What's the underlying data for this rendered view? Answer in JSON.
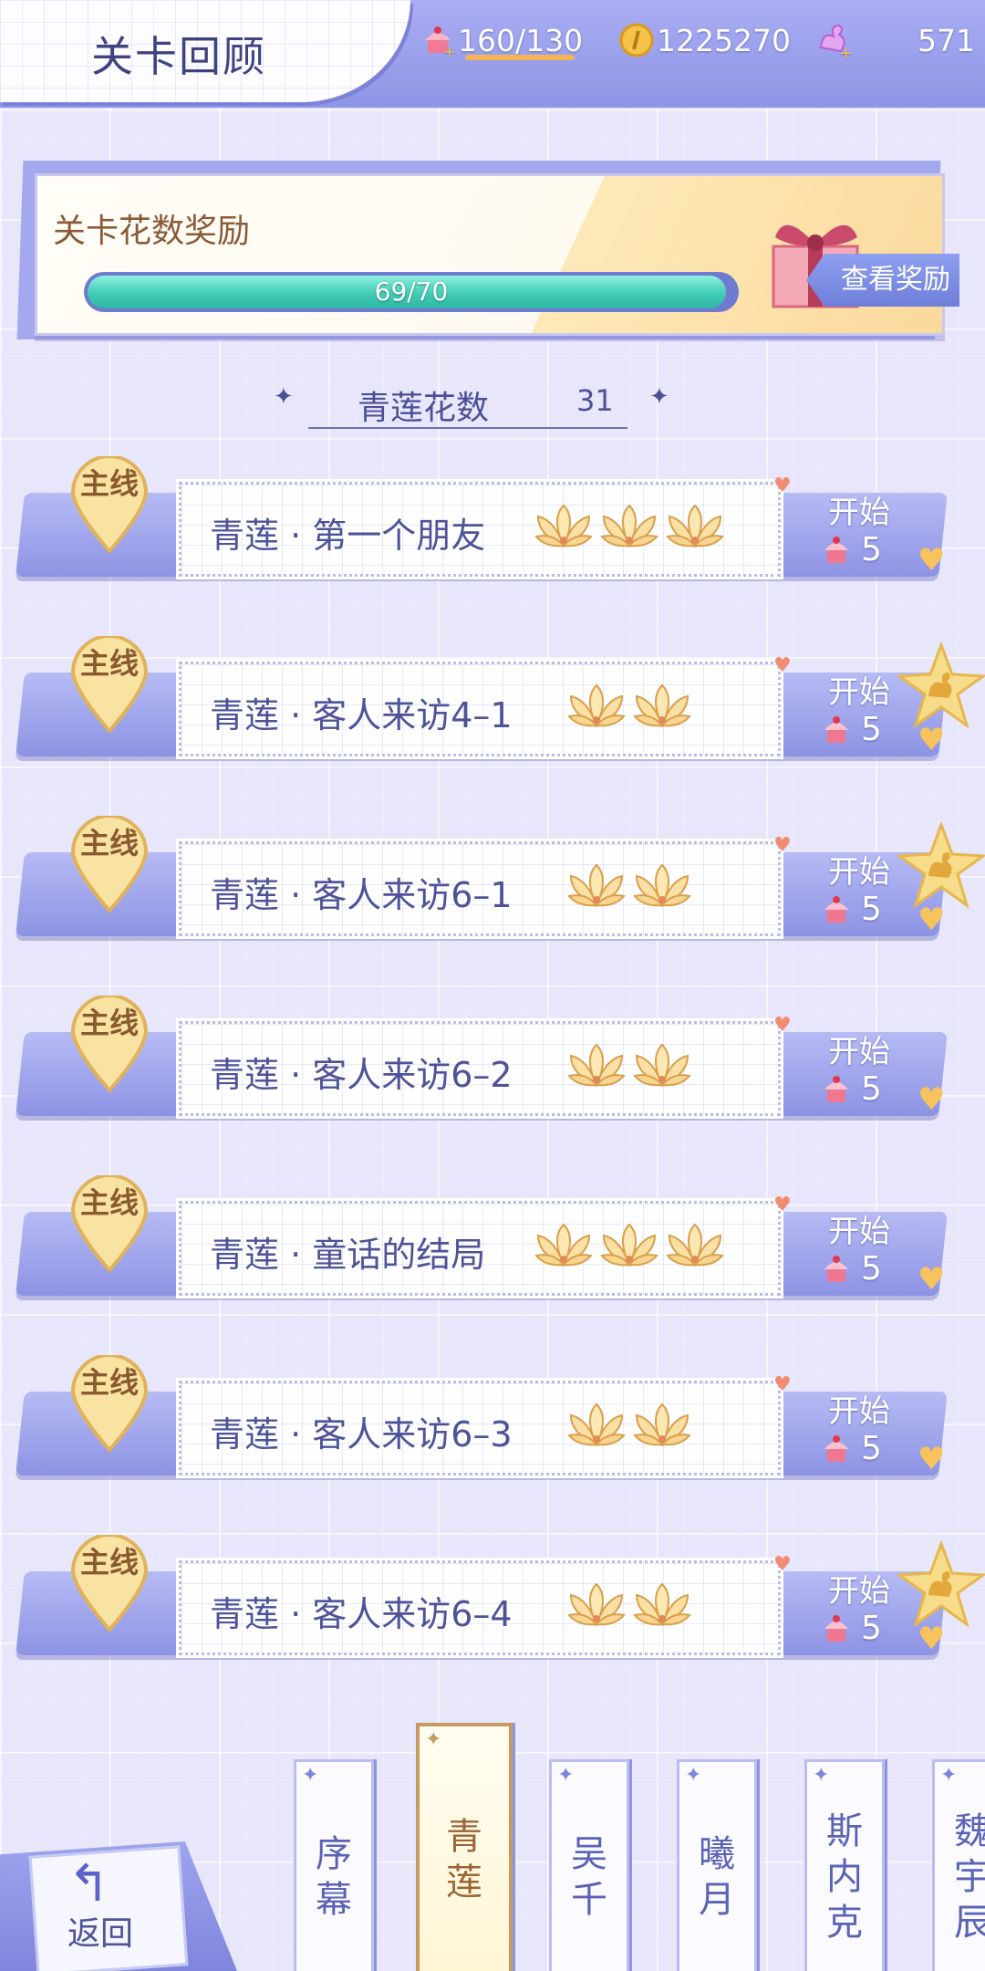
{
  "header": {
    "title": "关卡回顾",
    "stamina": "160/130",
    "coins": "1225270",
    "diamonds": "571"
  },
  "reward": {
    "title": "关卡花数奖励",
    "progress_text": "69/70",
    "progress_value": 0.9857,
    "button_label": "查看奖励"
  },
  "flower_count": {
    "label": "青莲花数",
    "value": "31"
  },
  "levels": [
    {
      "badge": "主线",
      "name": "青莲 · 第一个朋友",
      "flowers": 3,
      "start_label": "开始",
      "cost": "5",
      "star_badge": false
    },
    {
      "badge": "主线",
      "name": "青莲 · 客人来访4–1",
      "flowers": 2,
      "start_label": "开始",
      "cost": "5",
      "star_badge": true
    },
    {
      "badge": "主线",
      "name": "青莲 · 客人来访6–1",
      "flowers": 2,
      "start_label": "开始",
      "cost": "5",
      "star_badge": true
    },
    {
      "badge": "主线",
      "name": "青莲 · 客人来访6–2",
      "flowers": 2,
      "start_label": "开始",
      "cost": "5",
      "star_badge": false
    },
    {
      "badge": "主线",
      "name": "青莲 · 童话的结局",
      "flowers": 3,
      "start_label": "开始",
      "cost": "5",
      "star_badge": false
    },
    {
      "badge": "主线",
      "name": "青莲 · 客人来访6–3",
      "flowers": 2,
      "start_label": "开始",
      "cost": "5",
      "star_badge": false
    },
    {
      "badge": "主线",
      "name": "青莲 · 客人来访6–4",
      "flowers": 2,
      "start_label": "开始",
      "cost": "5",
      "star_badge": true
    }
  ],
  "tabs": [
    {
      "label": "序幕",
      "active": false
    },
    {
      "label": "青莲",
      "active": true
    },
    {
      "label": "吴千",
      "active": false
    },
    {
      "label": "曦月",
      "active": false
    },
    {
      "label": "斯内克",
      "active": false
    },
    {
      "label": "魏宇辰",
      "active": false
    }
  ],
  "back_button": {
    "label": "返回"
  },
  "icons": {
    "stamina": "cupcake-icon",
    "coins": "coin-icon",
    "diamonds": "swan-crystal-icon",
    "cost": "cupcake-icon",
    "flower": "lotus-flower-icon",
    "back": "return-arrow-icon"
  },
  "colors": {
    "accent": "#8f95e6",
    "progress": "#42cdb6",
    "badge_gold": "#f7d98a"
  }
}
